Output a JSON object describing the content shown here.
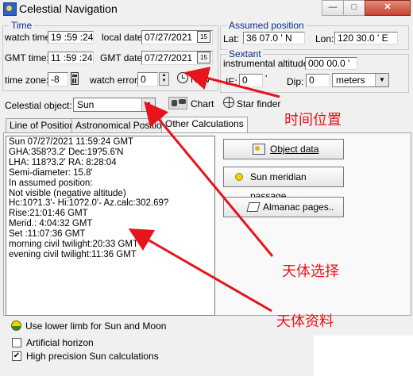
{
  "window": {
    "title": "Celestial Navigation",
    "min_label": "—",
    "max_label": "□",
    "close_label": "✕"
  },
  "time": {
    "group_title": "Time",
    "watch_time_label": "watch time:",
    "watch_time": "19 :59 :24",
    "local_date_label": "local date:",
    "local_date": "07/27/2021",
    "gmt_time_label": "GMT time:",
    "gmt_time": "11 :59 :24",
    "gmt_date_label": "GMT date:",
    "gmt_date": "07/27/2021",
    "calendar_label": "15",
    "time_zone_label": "time zone:",
    "time_zone": "-8",
    "watch_error_label": "watch error:",
    "watch_error": "0",
    "now_label": "Now"
  },
  "assumed": {
    "group_title": "Assumed position",
    "lat_label": "Lat:",
    "lat": "36 07.0 ' N",
    "lon_label": "Lon:",
    "lon": "120 30.0 ' E"
  },
  "sextant": {
    "group_title": "Sextant",
    "inst_alt_label": "instrumental altitude:",
    "inst_alt": "000 00.0 '",
    "ie_label": "IE:",
    "ie": "0",
    "ie_unit": "'",
    "dip_label": "Dip:",
    "dip": "0",
    "dip_unit": "meters"
  },
  "object": {
    "label": "Celestial object:",
    "value": "Sun",
    "chart_label": "Chart",
    "star_finder_label": "Star finder"
  },
  "tabs": [
    "Line of Position",
    "Astronomical Position",
    "Other Calculations"
  ],
  "output_lines": [
    "Sun 07/27/2021 11:59:24 GMT",
    "GHA:358?3.2'   Dec:19?5.6'N",
    "LHA: 118?3.2'   RA: 8:28:04",
    "Semi-diameter: 15.8'",
    "In assumed position:",
    "Not visible (negative altitude)",
    "Hc:10?1.3'- Hi:10?2.0'- Az.calc:302.69?",
    "Rise:21:01:46  GMT",
    "Merid.: 4:04:32  GMT",
    "Set  :11:07:36  GMT",
    "morning civil twilight:20:33  GMT",
    "evening civil twilight:11:36  GMT"
  ],
  "buttons": {
    "object_data": "Object data",
    "meridian_passage": "Sun meridian passage",
    "almanac": "Almanac pages.."
  },
  "options": {
    "lower_limb": "Use lower limb for Sun and Moon",
    "artificial_horizon": "Artificial horizon",
    "artificial_horizon_checked": false,
    "high_precision": "High precision Sun calculations",
    "high_precision_checked": true
  },
  "annotations": {
    "time_position": "时间位置",
    "object_select": "天体选择",
    "object_data": "天体资料"
  },
  "colors": {
    "annotation": "#e8141b",
    "group_title": "#0a2c88",
    "close_button": "#c7432f"
  }
}
